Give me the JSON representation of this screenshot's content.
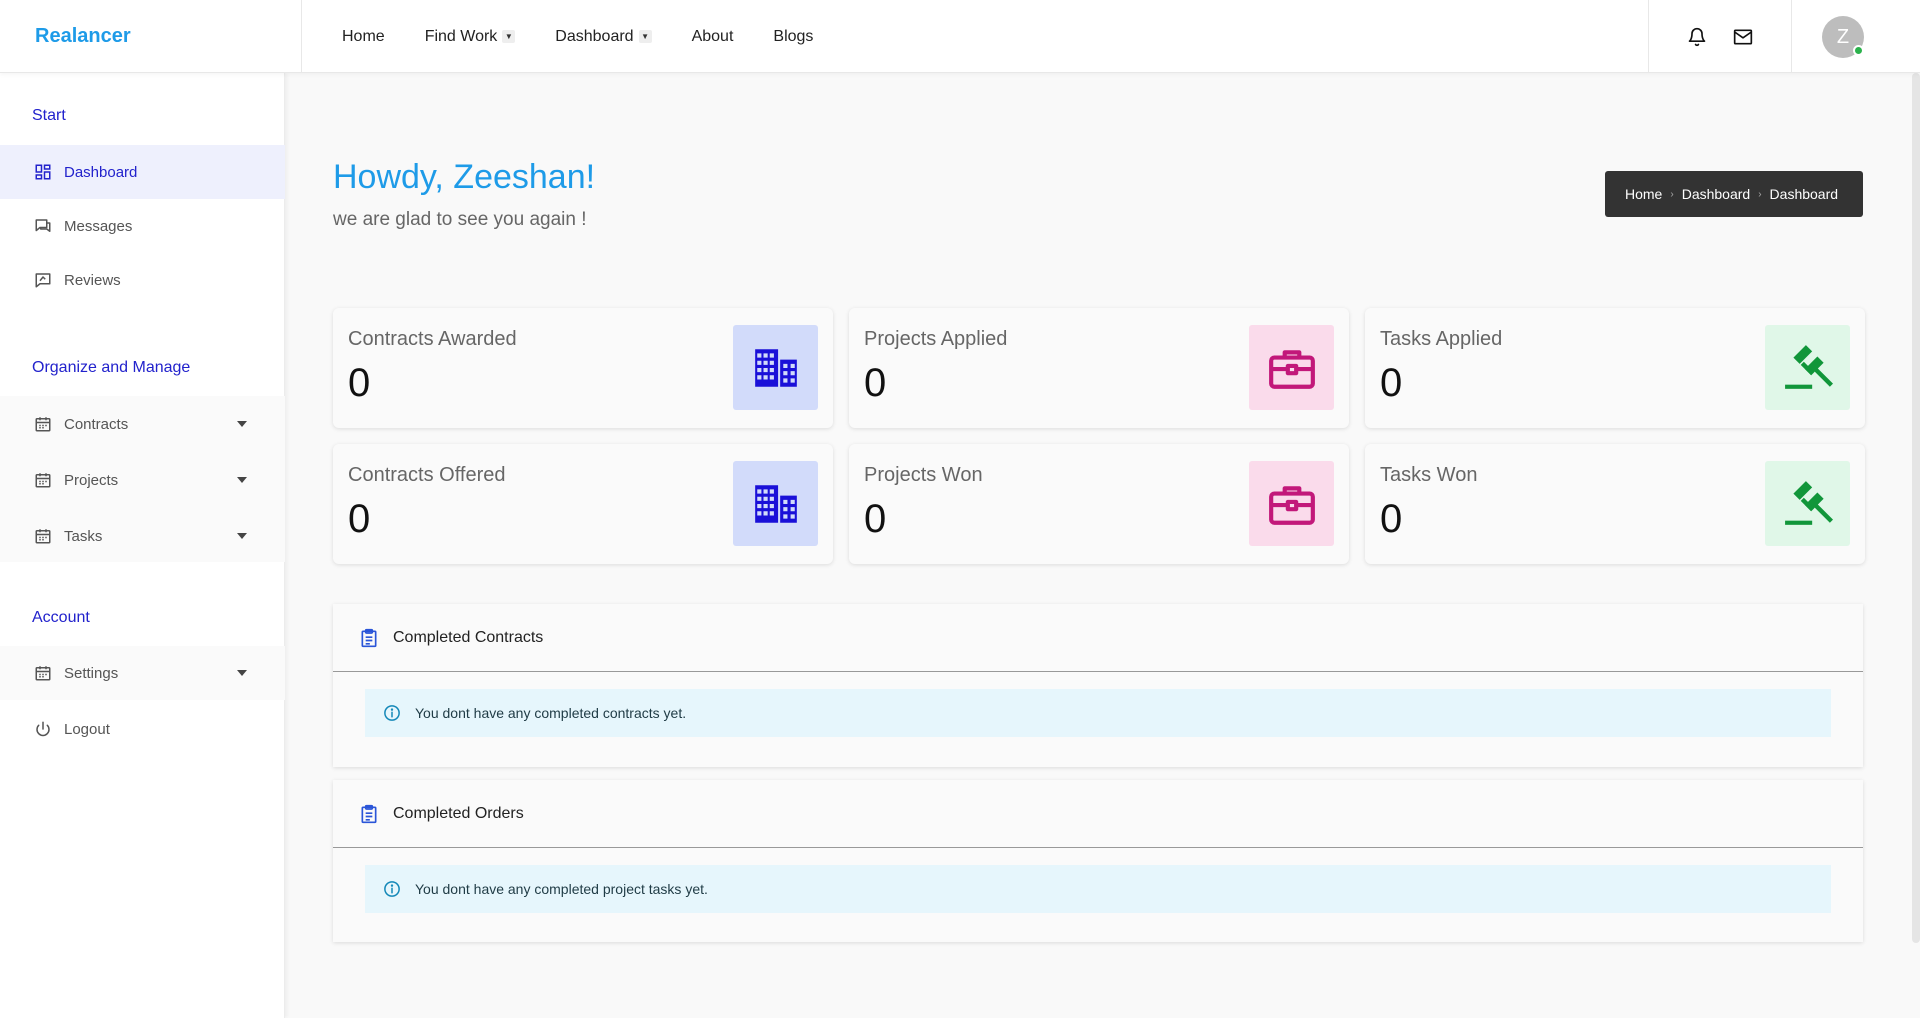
{
  "brand": {
    "name": "Realancer"
  },
  "nav": {
    "home": "Home",
    "find_work": "Find Work",
    "dashboard": "Dashboard",
    "about": "About",
    "blogs": "Blogs"
  },
  "user": {
    "initial": "Z",
    "status": "online"
  },
  "sidebar": {
    "start_heading": "Start",
    "dashboard": "Dashboard",
    "messages": "Messages",
    "reviews": "Reviews",
    "organize_heading": "Organize and Manage",
    "contracts": "Contracts",
    "projects": "Projects",
    "tasks": "Tasks",
    "account_heading": "Account",
    "settings": "Settings",
    "logout": "Logout"
  },
  "greeting": {
    "title": "Howdy, Zeeshan!",
    "subtitle": "we are glad to see you again !"
  },
  "breadcrumb": {
    "items": [
      "Home",
      "Dashboard",
      "Dashboard"
    ]
  },
  "stats": [
    {
      "label": "Contracts Awarded",
      "value": "0",
      "icon": "building-icon"
    },
    {
      "label": "Projects Applied",
      "value": "0",
      "icon": "briefcase-icon"
    },
    {
      "label": "Tasks Applied",
      "value": "0",
      "icon": "gavel-icon"
    },
    {
      "label": "Contracts Offered",
      "value": "0",
      "icon": "building-icon"
    },
    {
      "label": "Projects Won",
      "value": "0",
      "icon": "briefcase-icon"
    },
    {
      "label": "Tasks Won",
      "value": "0",
      "icon": "gavel-icon"
    }
  ],
  "colors": {
    "brand": "#1e9be8",
    "accent": "#2222cc",
    "building": "#1a10d8",
    "building_bg": "#d2dbfa",
    "briefcase": "#c2187a",
    "briefcase_bg": "#fadbeb",
    "gavel": "#11963a",
    "gavel_bg": "#e0f7e8"
  },
  "panels": {
    "contracts_title": "Completed Contracts",
    "contracts_empty": "You dont have any completed contracts yet.",
    "orders_title": "Completed Orders",
    "orders_empty": "You dont have any completed project tasks yet."
  }
}
